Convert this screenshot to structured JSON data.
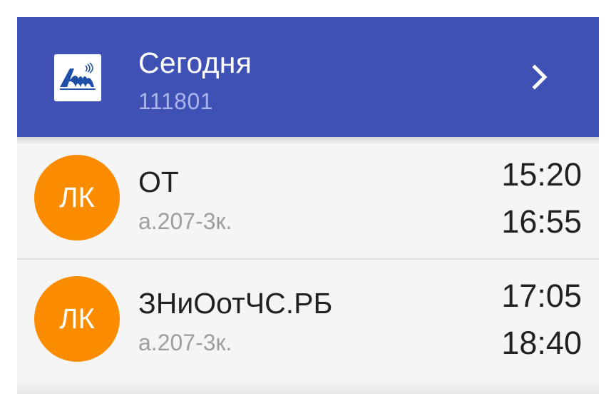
{
  "header": {
    "title": "Сегодня",
    "group_number": "111801",
    "logo_icon": "university-logo-icon",
    "next_icon": "chevron-right-icon"
  },
  "lessons": [
    {
      "type_badge": "ЛК",
      "subject": "ОТ",
      "room": "а.207-3к.",
      "start_time": "15:20",
      "end_time": "16:55"
    },
    {
      "type_badge": "ЛК",
      "subject": "ЗНиОотЧС.РБ",
      "room": "а.207-3к.",
      "start_time": "17:05",
      "end_time": "18:40"
    }
  ],
  "colors": {
    "header_background": "#3f51b5",
    "header_subtitle": "#aab4ee",
    "badge_background": "#fb8c00",
    "list_background": "#f5f5f5"
  }
}
